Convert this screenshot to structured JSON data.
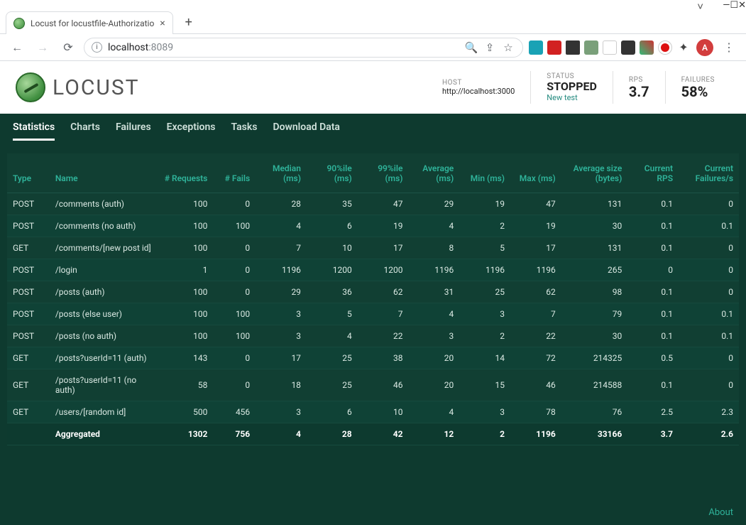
{
  "browser": {
    "tab_title": "Locust for locustfile-Authorizatio",
    "url_host": "localhost",
    "url_port": ":8089",
    "avatar_initial": "A"
  },
  "header": {
    "logo_text": "LOCUST",
    "host_label": "HOST",
    "host_value": "http://localhost:3000",
    "status_label": "STATUS",
    "status_value": "STOPPED",
    "status_link": "New test",
    "rps_label": "RPS",
    "rps_value": "3.7",
    "failures_label": "FAILURES",
    "failures_value": "58%"
  },
  "tabs": [
    "Statistics",
    "Charts",
    "Failures",
    "Exceptions",
    "Tasks",
    "Download Data"
  ],
  "table": {
    "headers": {
      "type": "Type",
      "name": "Name",
      "requests": "# Requests",
      "fails": "# Fails",
      "median": "Median (ms)",
      "p90": "90%ile (ms)",
      "p99": "99%ile (ms)",
      "avg": "Average (ms)",
      "min": "Min (ms)",
      "max": "Max (ms)",
      "size": "Average size (bytes)",
      "rps": "Current RPS",
      "fs": "Current Failures/s"
    },
    "rows": [
      {
        "type": "POST",
        "name": "/comments (auth)",
        "req": "100",
        "fail": "0",
        "med": "28",
        "p90": "35",
        "p99": "47",
        "avg": "29",
        "min": "19",
        "max": "47",
        "size": "131",
        "rps": "0.1",
        "fs": "0"
      },
      {
        "type": "POST",
        "name": "/comments (no auth)",
        "req": "100",
        "fail": "100",
        "med": "4",
        "p90": "6",
        "p99": "19",
        "avg": "4",
        "min": "2",
        "max": "19",
        "size": "30",
        "rps": "0.1",
        "fs": "0.1"
      },
      {
        "type": "GET",
        "name": "/comments/[new post id]",
        "req": "100",
        "fail": "0",
        "med": "7",
        "p90": "10",
        "p99": "17",
        "avg": "8",
        "min": "5",
        "max": "17",
        "size": "131",
        "rps": "0.1",
        "fs": "0"
      },
      {
        "type": "POST",
        "name": "/login",
        "req": "1",
        "fail": "0",
        "med": "1196",
        "p90": "1200",
        "p99": "1200",
        "avg": "1196",
        "min": "1196",
        "max": "1196",
        "size": "265",
        "rps": "0",
        "fs": "0"
      },
      {
        "type": "POST",
        "name": "/posts (auth)",
        "req": "100",
        "fail": "0",
        "med": "29",
        "p90": "36",
        "p99": "62",
        "avg": "31",
        "min": "25",
        "max": "62",
        "size": "98",
        "rps": "0.1",
        "fs": "0"
      },
      {
        "type": "POST",
        "name": "/posts (else user)",
        "req": "100",
        "fail": "100",
        "med": "3",
        "p90": "5",
        "p99": "7",
        "avg": "4",
        "min": "3",
        "max": "7",
        "size": "79",
        "rps": "0.1",
        "fs": "0.1"
      },
      {
        "type": "POST",
        "name": "/posts (no auth)",
        "req": "100",
        "fail": "100",
        "med": "3",
        "p90": "4",
        "p99": "22",
        "avg": "3",
        "min": "2",
        "max": "22",
        "size": "30",
        "rps": "0.1",
        "fs": "0.1"
      },
      {
        "type": "GET",
        "name": "/posts?userId=11 (auth)",
        "req": "143",
        "fail": "0",
        "med": "17",
        "p90": "25",
        "p99": "38",
        "avg": "20",
        "min": "14",
        "max": "72",
        "size": "214325",
        "rps": "0.5",
        "fs": "0"
      },
      {
        "type": "GET",
        "name": "/posts?userId=11 (no auth)",
        "req": "58",
        "fail": "0",
        "med": "18",
        "p90": "25",
        "p99": "46",
        "avg": "20",
        "min": "15",
        "max": "46",
        "size": "214588",
        "rps": "0.1",
        "fs": "0"
      },
      {
        "type": "GET",
        "name": "/users/[random id]",
        "req": "500",
        "fail": "456",
        "med": "3",
        "p90": "6",
        "p99": "10",
        "avg": "4",
        "min": "3",
        "max": "78",
        "size": "76",
        "rps": "2.5",
        "fs": "2.3"
      }
    ],
    "aggregated": {
      "type": "",
      "name": "Aggregated",
      "req": "1302",
      "fail": "756",
      "med": "4",
      "p90": "28",
      "p99": "42",
      "avg": "12",
      "min": "2",
      "max": "1196",
      "size": "33166",
      "rps": "3.7",
      "fs": "2.6"
    }
  },
  "footer": {
    "about": "About"
  }
}
